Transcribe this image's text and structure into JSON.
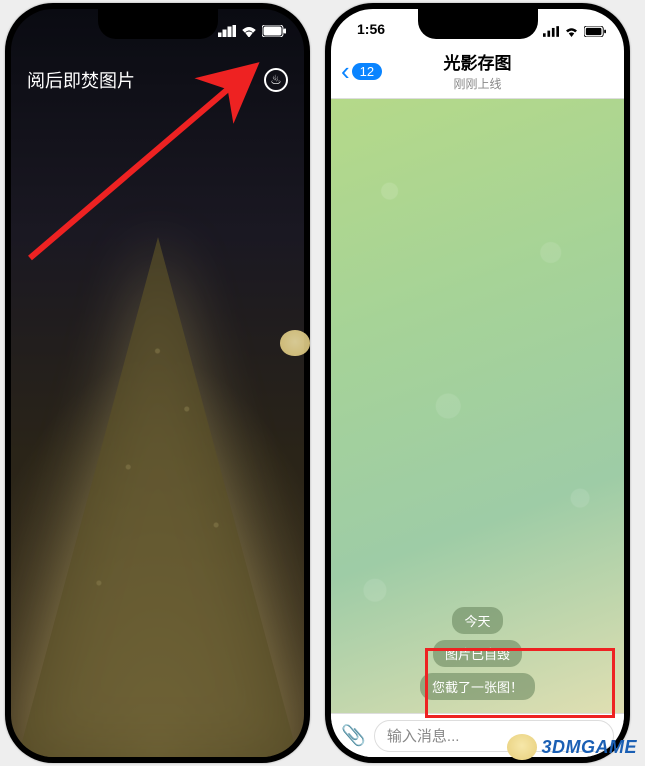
{
  "left": {
    "title": "阅后即焚图片",
    "burn_glyph": "♨"
  },
  "right": {
    "statusbar": {
      "time": "1:56"
    },
    "back_badge": "12",
    "chat_title": "光影存图",
    "chat_subtitle": "刚刚上线",
    "date_label": "今天",
    "msg1": "图片已自毁",
    "msg2": "您截了一张图！",
    "input_placeholder": "输入消息..."
  },
  "watermark": {
    "text": "3DMGAME"
  }
}
